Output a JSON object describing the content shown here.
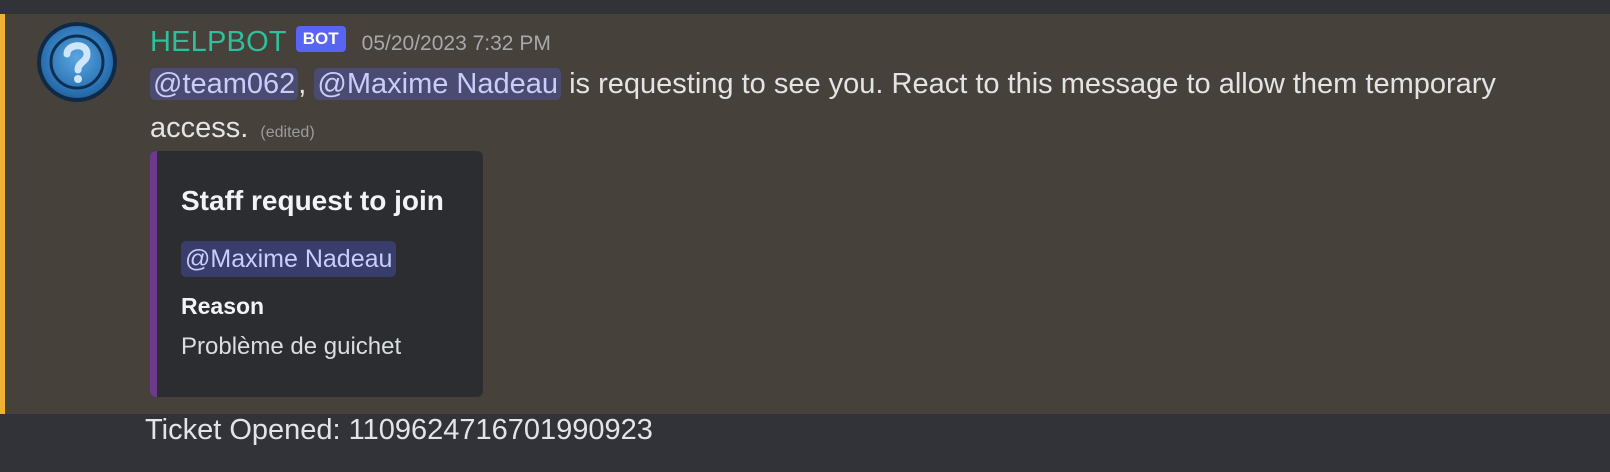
{
  "message": {
    "author": "HELPBOT",
    "bot_tag": "BOT",
    "timestamp": "05/20/2023 7:32 PM",
    "mention_1": "@team062",
    "separator": ",",
    "mention_2": "@Maxime Nadeau",
    "text": " is requesting to see you. React to this message to allow them temporary access.",
    "edited_label": "(edited)",
    "highlight_color": "#f0b232"
  },
  "embed": {
    "title": "Staff request to join",
    "mention": "@Maxime Nadeau",
    "field_name": "Reason",
    "field_value": "Problème de guichet",
    "accent_color": "#6d3a8e"
  },
  "next_message": {
    "text": "Ticket Opened: 1109624716701990923"
  }
}
